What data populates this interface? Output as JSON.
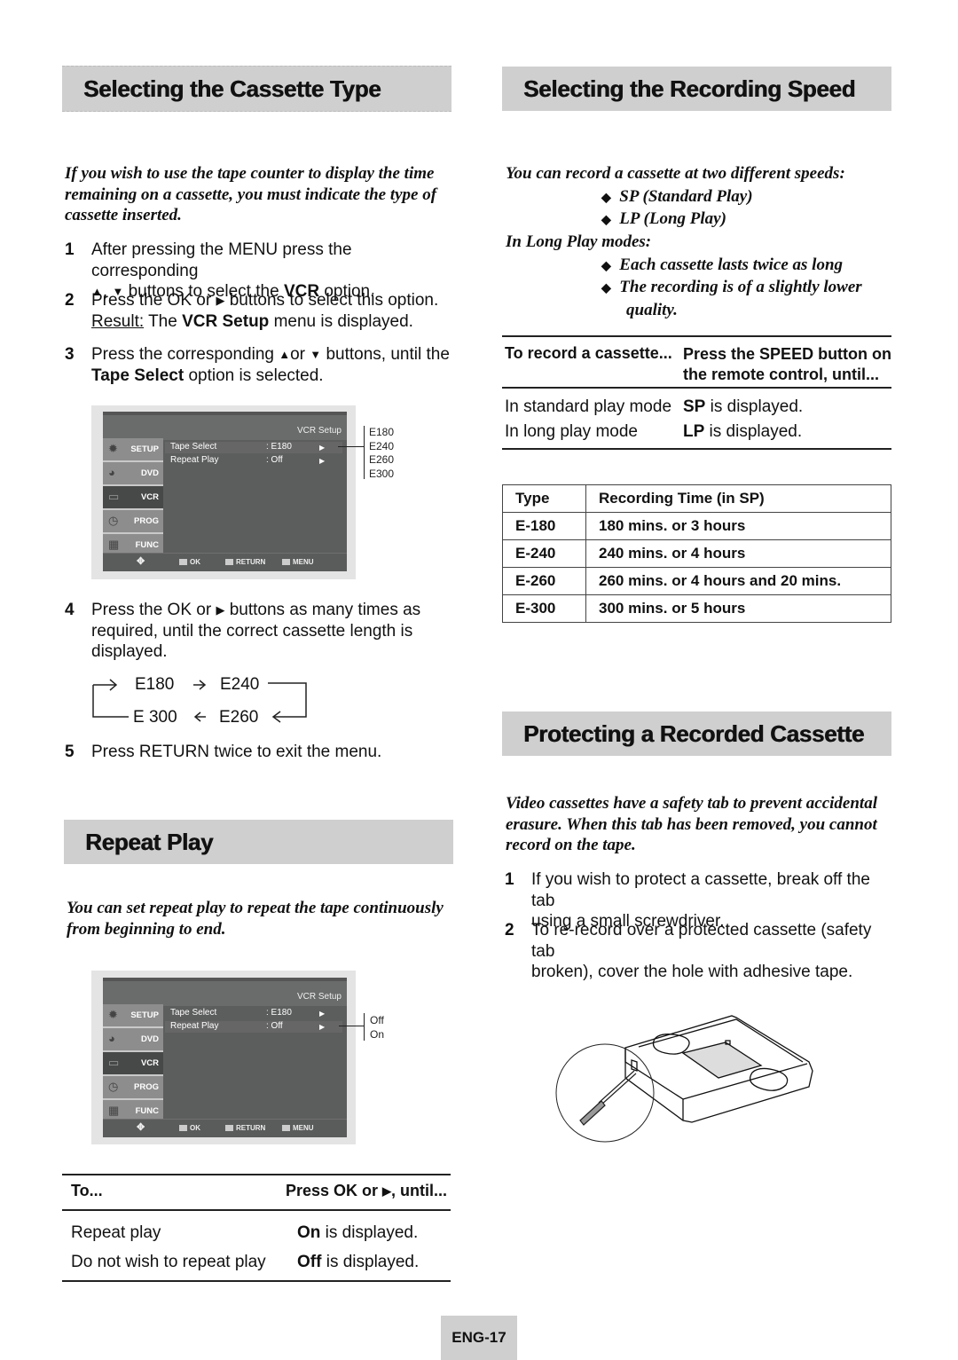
{
  "left": {
    "cassette_type": {
      "heading": "Selecting the Cassette Type",
      "intro": "If you wish to use the tape counter to display the time remaining on a cassette, you must indicate the type of cassette inserted.",
      "steps": [
        {
          "num": "1",
          "line1": "After pressing the MENU press the corresponding",
          "line2_pre": " buttons to select the ",
          "line2_bold": "VCR",
          "line2_post": " option."
        },
        {
          "num": "2",
          "line1": "Press the OK or ",
          "line1_post": " buttons to select this option.",
          "result_label": "Result:",
          "result_pre": " The ",
          "result_bold": "VCR Setup",
          "result_post": " menu is displayed."
        },
        {
          "num": "3",
          "line1_pre": "Press the corresponding ",
          "line1_mid": "or ",
          "line1_post": " buttons, until the",
          "line2_bold": "Tape Select",
          "line2_post": " option is selected."
        },
        {
          "num": "4",
          "line1_pre": "Press the OK or ",
          "line1_post": " buttons as many times as",
          "line2": "required, until the correct cassette length is",
          "line3": "displayed."
        },
        {
          "num": "5",
          "line1": "Press RETURN twice to exit the menu."
        }
      ],
      "osd": {
        "title": "VCR Setup",
        "menu": [
          {
            "label": "SETUP",
            "icon": "gear-icon"
          },
          {
            "label": "DVD",
            "icon": "dvd-disc-icon"
          },
          {
            "label": "VCR",
            "icon": "vcr-icon"
          },
          {
            "label": "PROG",
            "icon": "clock-icon"
          },
          {
            "label": "FUNC",
            "icon": "hand-icon"
          }
        ],
        "rows": [
          {
            "name": "Tape Select",
            "value": ": E180",
            "arrow": "▶"
          },
          {
            "name": "Repeat Play",
            "value": ": Off",
            "arrow": "▶"
          }
        ],
        "footer": {
          "move": "✥",
          "ok": "OK",
          "return": "RETURN",
          "menu": "MENU"
        },
        "options": [
          "E180",
          "E240",
          "E260",
          "E300"
        ]
      },
      "cycle": {
        "a": "E180",
        "b": "E240",
        "c": "E260",
        "d": "E 300"
      }
    },
    "repeat_play": {
      "heading": "Repeat Play",
      "intro": "You can set repeat play to repeat the tape continuously from beginning to end.",
      "osd": {
        "title": "VCR Setup",
        "options": [
          "Off",
          "On"
        ]
      },
      "table": {
        "col1": "To...",
        "col2_pre": "Press OK or ",
        "col2_post": ", until...",
        "rows": [
          {
            "action": "Repeat play",
            "result_bold": "On",
            "result_post": " is displayed."
          },
          {
            "action": "Do not wish to repeat play",
            "result_bold": "Off",
            "result_post": " is displayed."
          }
        ]
      }
    }
  },
  "right": {
    "recording_speed": {
      "heading": "Selecting the Recording Speed",
      "intro": "You can record a cassette at two different speeds:",
      "speeds": [
        "SP (Standard Play)",
        "LP (Long Play)"
      ],
      "lp_heading": "In Long Play modes:",
      "lp_notes": [
        "Each cassette lasts twice as long",
        "The recording is of a slightly lower",
        "quality."
      ],
      "speed_table": {
        "col1": "To record a cassette...",
        "col2_l1": "Press the SPEED button on",
        "col2_l2": "the remote control, until...",
        "rows": [
          {
            "mode": "In standard play mode",
            "bold": "SP",
            "post": " is displayed."
          },
          {
            "mode": "In long play mode",
            "bold": "LP",
            "post": " is displayed."
          }
        ]
      },
      "type_table": {
        "headers": [
          "Type",
          "Recording Time (in SP)"
        ],
        "rows": [
          [
            "E-180",
            "180 mins. or 3 hours"
          ],
          [
            "E-240",
            "240 mins. or 4 hours"
          ],
          [
            "E-260",
            "260 mins. or 4 hours and 20 mins."
          ],
          [
            "E-300",
            "300 mins. or 5 hours"
          ]
        ]
      }
    },
    "protecting": {
      "heading": "Protecting a Recorded Cassette",
      "intro": "Video cassettes have a safety tab to prevent accidental erasure. When this tab has been removed, you cannot record on the tape.",
      "steps": [
        {
          "num": "1",
          "l1": "If you wish to protect a cassette, break off the tab",
          "l2": "using a small screwdriver."
        },
        {
          "num": "2",
          "l1": "To re-record over a protected cassette (safety tab",
          "l2": "broken), cover the hole with adhesive tape."
        }
      ]
    }
  },
  "page_number": "ENG-17",
  "glyphs": {
    "up": "▲",
    "down": "▼",
    "right": "▶",
    "diamond": "◆"
  }
}
